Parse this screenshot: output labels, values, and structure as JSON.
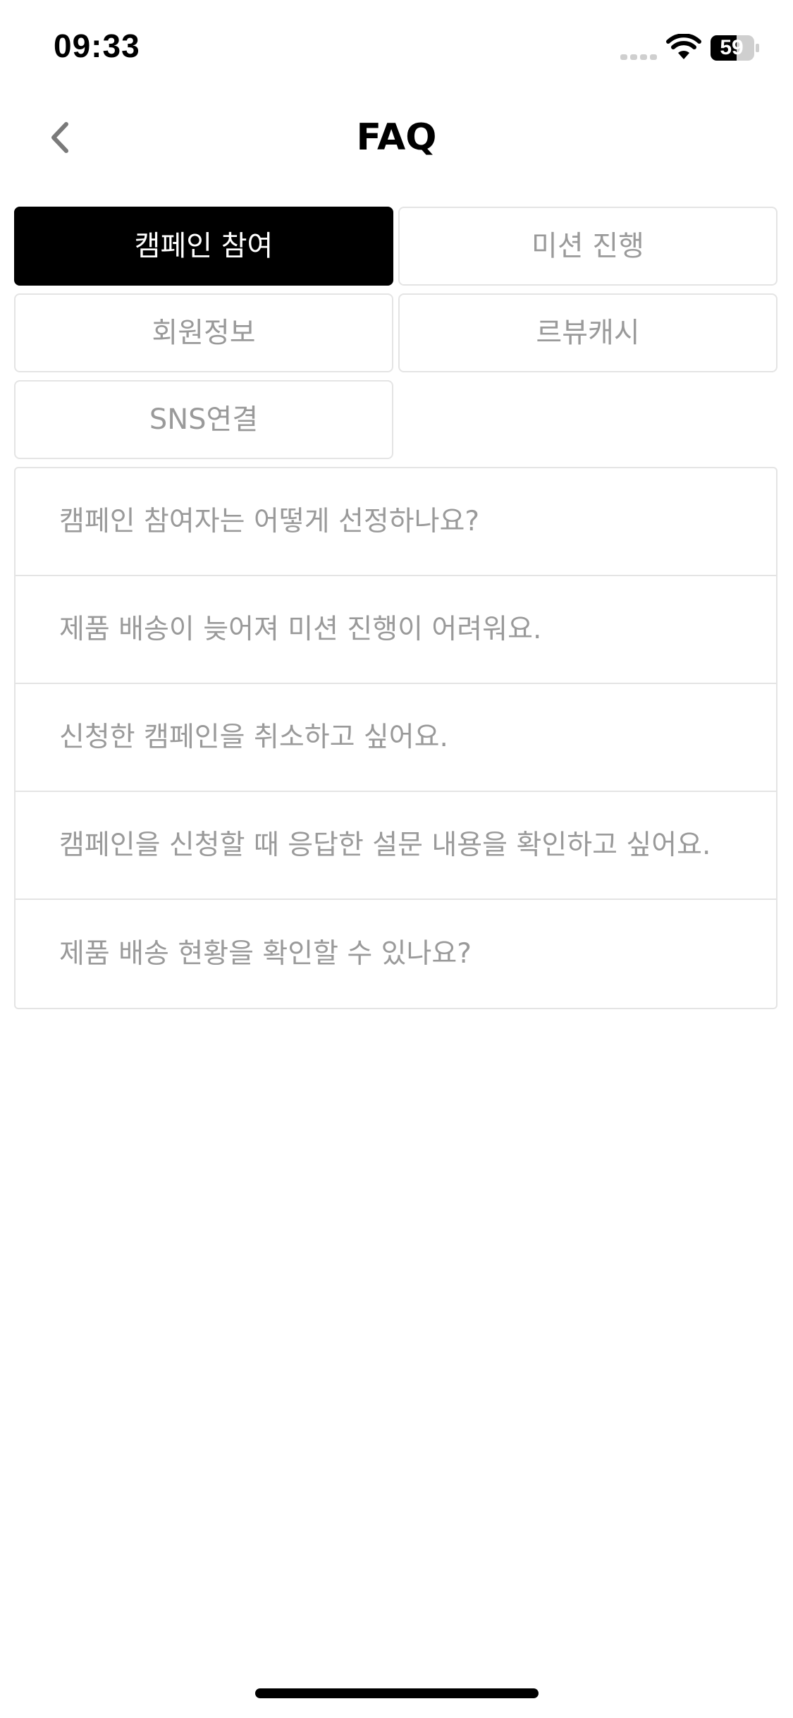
{
  "status_bar": {
    "time": "09:33",
    "battery": "59",
    "icons": [
      "signal-dots-icon",
      "wifi-icon",
      "battery-icon"
    ]
  },
  "header": {
    "title": "FAQ",
    "back_icon": "chevron-left-icon"
  },
  "tabs": [
    {
      "label": "캠페인 참여",
      "active": true
    },
    {
      "label": "미션 진행",
      "active": false
    },
    {
      "label": "회원정보",
      "active": false
    },
    {
      "label": "르뷰캐시",
      "active": false
    },
    {
      "label": "SNS연결",
      "active": false
    }
  ],
  "faq": {
    "items": [
      {
        "question": "캠페인 참여자는 어떻게 선정하나요?"
      },
      {
        "question": "제품 배송이 늦어져 미션 진행이 어려워요."
      },
      {
        "question": "신청한 캠페인을 취소하고 싶어요."
      },
      {
        "question": "캠페인을 신청할 때 응답한 설문 내용을 확인하고 싶어요."
      },
      {
        "question": "제품 배송 현황을 확인할 수 있나요?"
      }
    ]
  },
  "colors": {
    "active_tab_bg": "#000000",
    "active_tab_text": "#ffffff",
    "inactive_text": "#9a9a9a",
    "border": "#e4e4e4"
  }
}
